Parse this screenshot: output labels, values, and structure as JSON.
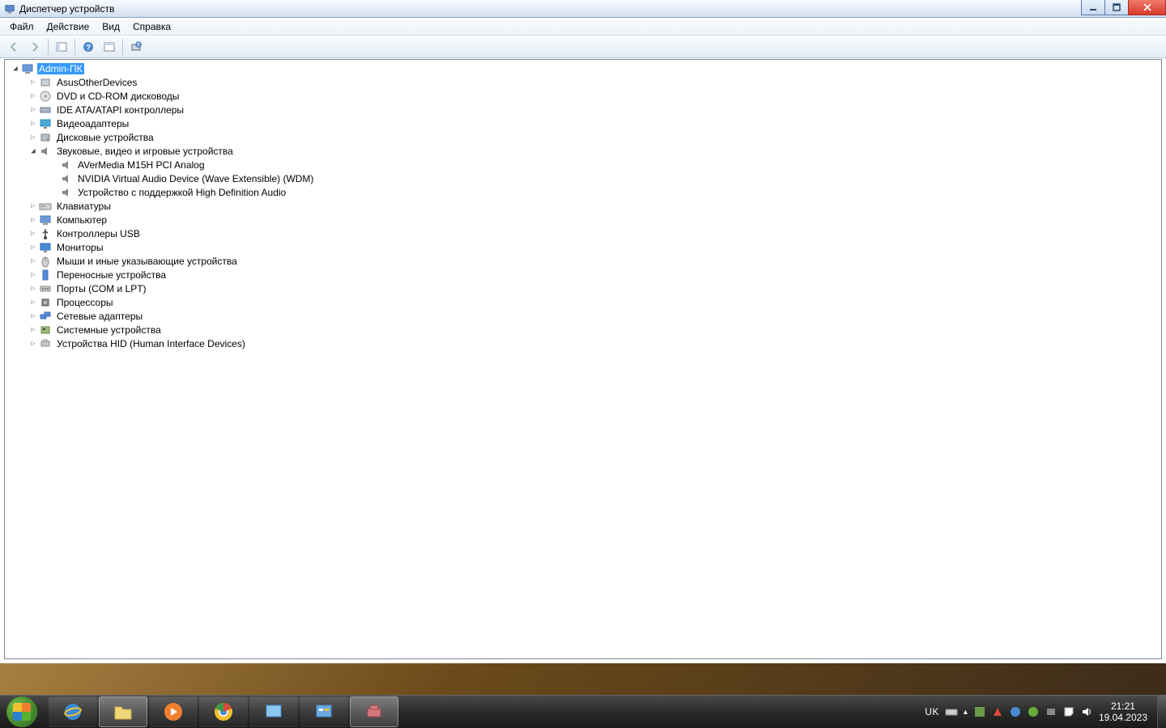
{
  "window": {
    "title": "Диспетчер устройств"
  },
  "menu": {
    "file": "Файл",
    "action": "Действие",
    "view": "Вид",
    "help": "Справка"
  },
  "tree": {
    "root": "Admin-ПК",
    "nodes": [
      {
        "label": "AsusOtherDevices",
        "icon": "generic"
      },
      {
        "label": "DVD и CD-ROM дисководы",
        "icon": "disc"
      },
      {
        "label": "IDE ATA/ATAPI контроллеры",
        "icon": "ide"
      },
      {
        "label": "Видеоадаптеры",
        "icon": "display"
      },
      {
        "label": "Дисковые устройства",
        "icon": "disk"
      },
      {
        "label": "Звуковые, видео и игровые устройства",
        "icon": "sound",
        "expanded": true,
        "children": [
          {
            "label": "AVerMedia M15H PCI Analog",
            "icon": "sound"
          },
          {
            "label": "NVIDIA Virtual Audio Device (Wave Extensible) (WDM)",
            "icon": "sound"
          },
          {
            "label": "Устройство с поддержкой High Definition Audio",
            "icon": "sound"
          }
        ]
      },
      {
        "label": "Клавиатуры",
        "icon": "keyboard"
      },
      {
        "label": "Компьютер",
        "icon": "computer"
      },
      {
        "label": "Контроллеры USB",
        "icon": "usb"
      },
      {
        "label": "Мониторы",
        "icon": "monitor"
      },
      {
        "label": "Мыши и иные указывающие устройства",
        "icon": "mouse"
      },
      {
        "label": "Переносные устройства",
        "icon": "portable"
      },
      {
        "label": "Порты (COM и LPT)",
        "icon": "port"
      },
      {
        "label": "Процессоры",
        "icon": "cpu"
      },
      {
        "label": "Сетевые адаптеры",
        "icon": "network"
      },
      {
        "label": "Системные устройства",
        "icon": "system"
      },
      {
        "label": "Устройства HID (Human Interface Devices)",
        "icon": "hid"
      }
    ]
  },
  "tray": {
    "lang": "UK",
    "time": "21:21",
    "date": "19.04.2023"
  }
}
